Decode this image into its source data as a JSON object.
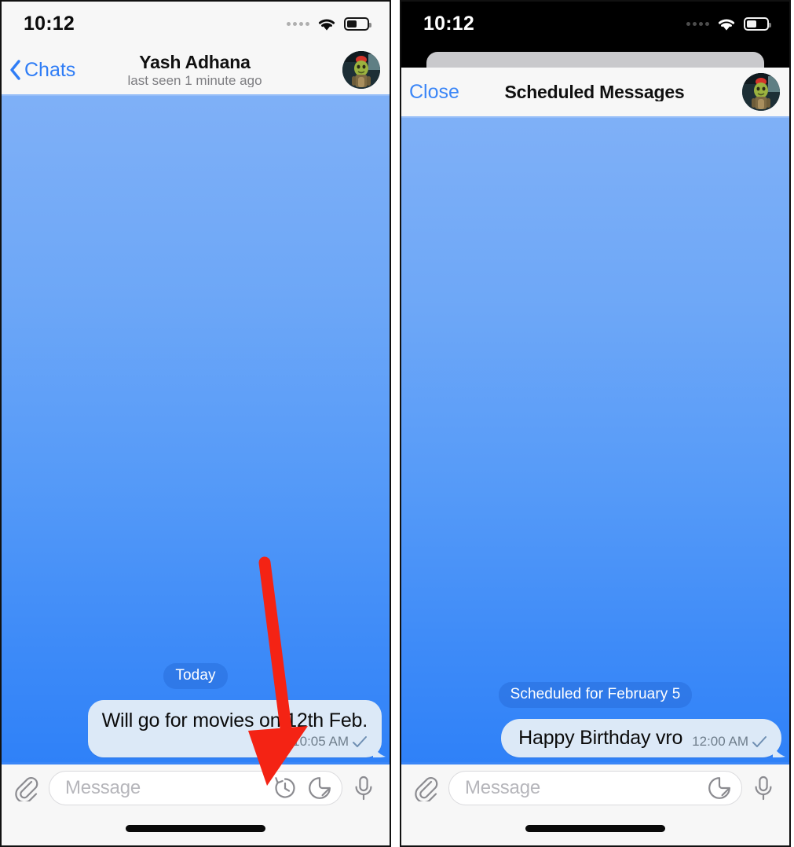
{
  "meta": {
    "accent_blue": "#3b86f7",
    "bubble_bg": "#dce9f7",
    "annotation_red": "#f42314",
    "chat_gradient_top": "#7fb0f7",
    "chat_gradient_bottom": "#2f81f8"
  },
  "left_panel": {
    "status_bar": {
      "time": "10:12",
      "wifi": "wifi-icon",
      "battery": "battery-icon",
      "signal": "signal-dots-icon"
    },
    "navbar": {
      "back_label": "Chats",
      "back_icon": "chevron-left-icon",
      "title": "Yash Adhana",
      "subtitle": "last seen 1 minute ago",
      "avatar": "contact-avatar"
    },
    "chat": {
      "day_divider": "Today",
      "messages": [
        {
          "text": "Will go for movies on 12th Feb.",
          "time": "10:05 AM",
          "status_icon": "single-check-icon",
          "outgoing": true
        }
      ]
    },
    "composer": {
      "attach_icon": "paperclip-icon",
      "placeholder": "Message",
      "schedule_icon": "schedule-clock-icon",
      "sticker_icon": "sticker-icon",
      "mic_icon": "microphone-icon"
    }
  },
  "right_panel": {
    "status_bar": {
      "time": "10:12",
      "wifi": "wifi-icon",
      "battery": "battery-icon",
      "signal": "signal-dots-icon"
    },
    "navbar": {
      "close_label": "Close",
      "title": "Scheduled Messages",
      "avatar": "contact-avatar"
    },
    "chat": {
      "day_divider": "Scheduled for February 5",
      "messages": [
        {
          "text": "Happy Birthday vro",
          "time": "12:00 AM",
          "status_icon": "single-check-icon",
          "outgoing": true
        }
      ]
    },
    "composer": {
      "attach_icon": "paperclip-icon",
      "placeholder": "Message",
      "sticker_icon": "sticker-icon",
      "mic_icon": "microphone-icon"
    }
  },
  "annotation": {
    "type": "arrow",
    "color": "#f42314",
    "points_to": "schedule-clock-icon"
  }
}
